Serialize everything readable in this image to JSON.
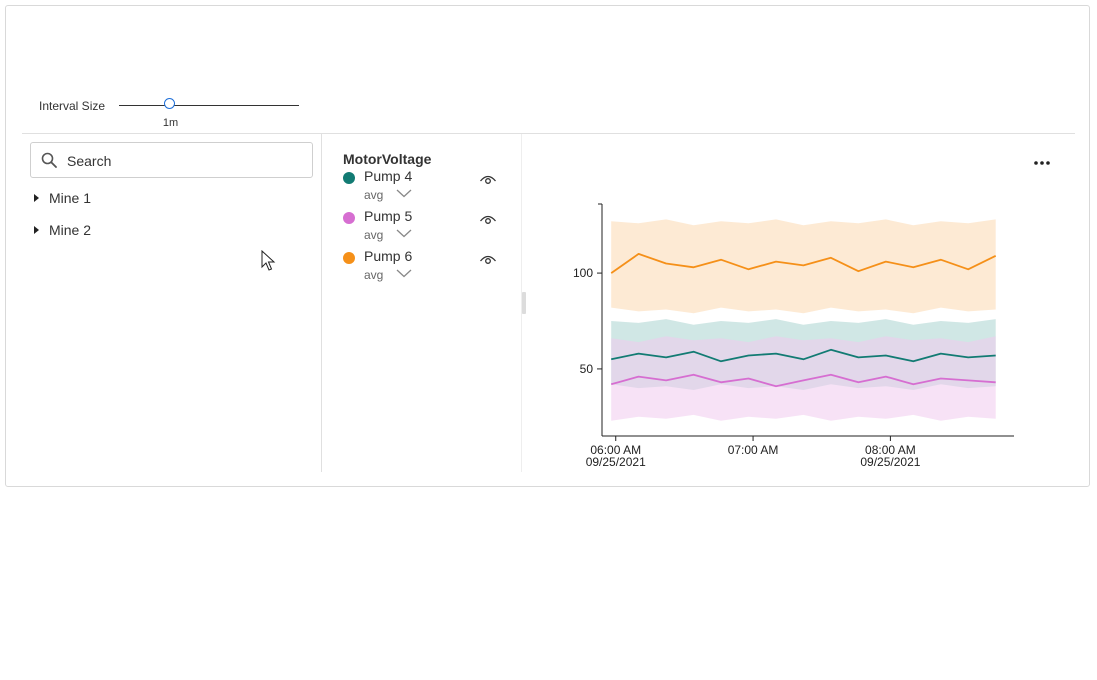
{
  "interval": {
    "label": "Interval Size",
    "value": "1m",
    "slider_fraction": 0.28
  },
  "search": {
    "placeholder": "Search",
    "value": ""
  },
  "tree": {
    "items": [
      {
        "label": "Mine 1"
      },
      {
        "label": "Mine 2"
      }
    ]
  },
  "legend": {
    "title": "MotorVoltage",
    "items": [
      {
        "name": "Pump 4",
        "aggregate": "avg",
        "color": "#127b73",
        "icons": [
          "chevron-down-icon",
          "eye-icon"
        ]
      },
      {
        "name": "Pump 5",
        "aggregate": "avg",
        "color": "#d66ed1",
        "icons": [
          "chevron-down-icon",
          "eye-icon"
        ]
      },
      {
        "name": "Pump 6",
        "aggregate": "avg",
        "color": "#f59019",
        "icons": [
          "chevron-down-icon",
          "eye-icon"
        ]
      }
    ]
  },
  "chart_data": {
    "type": "line",
    "ylim": [
      15,
      135
    ],
    "yticks": [
      {
        "value": 50,
        "label": "50"
      },
      {
        "value": 100,
        "label": "100"
      }
    ],
    "xlim": [
      "2021-09-25T05:54",
      "2021-09-25T08:54"
    ],
    "xticks": [
      {
        "time": "2021-09-25T06:00",
        "label": "06:00 AM",
        "sublabel": "09/25/2021"
      },
      {
        "time": "2021-09-25T07:00",
        "label": "07:00 AM",
        "sublabel": ""
      },
      {
        "time": "2021-09-25T08:00",
        "label": "08:00 AM",
        "sublabel": "09/25/2021"
      }
    ],
    "series": [
      {
        "name": "Pump 6",
        "color": "#f59019",
        "band_color": "#fcd9b0",
        "x": [
          "2021-09-25T05:58",
          "2021-09-25T06:10",
          "2021-09-25T06:22",
          "2021-09-25T06:34",
          "2021-09-25T06:46",
          "2021-09-25T06:58",
          "2021-09-25T07:10",
          "2021-09-25T07:22",
          "2021-09-25T07:34",
          "2021-09-25T07:46",
          "2021-09-25T07:58",
          "2021-09-25T08:10",
          "2021-09-25T08:22",
          "2021-09-25T08:34",
          "2021-09-25T08:46"
        ],
        "avg": [
          100,
          110,
          105,
          103,
          107,
          102,
          106,
          104,
          108,
          101,
          106,
          103,
          107,
          102,
          109
        ],
        "min": [
          82,
          80,
          81,
          79,
          82,
          80,
          81,
          79,
          82,
          80,
          81,
          79,
          82,
          80,
          81
        ],
        "max": [
          127,
          126,
          128,
          125,
          127,
          126,
          128,
          125,
          127,
          126,
          128,
          125,
          127,
          126,
          128
        ]
      },
      {
        "name": "Pump 4",
        "color": "#127b73",
        "band_color": "#a9d4cf",
        "x": [
          "2021-09-25T05:58",
          "2021-09-25T06:10",
          "2021-09-25T06:22",
          "2021-09-25T06:34",
          "2021-09-25T06:46",
          "2021-09-25T06:58",
          "2021-09-25T07:10",
          "2021-09-25T07:22",
          "2021-09-25T07:34",
          "2021-09-25T07:46",
          "2021-09-25T07:58",
          "2021-09-25T08:10",
          "2021-09-25T08:22",
          "2021-09-25T08:34",
          "2021-09-25T08:46"
        ],
        "avg": [
          55,
          58,
          56,
          59,
          54,
          57,
          58,
          55,
          60,
          56,
          57,
          54,
          58,
          56,
          57
        ],
        "min": [
          42,
          40,
          41,
          39,
          42,
          40,
          41,
          39,
          42,
          40,
          41,
          39,
          42,
          40,
          41
        ],
        "max": [
          75,
          74,
          76,
          73,
          75,
          74,
          76,
          73,
          75,
          74,
          76,
          73,
          75,
          74,
          76
        ]
      },
      {
        "name": "Pump 5",
        "color": "#d66ed1",
        "band_color": "#f0cbee",
        "x": [
          "2021-09-25T05:58",
          "2021-09-25T06:10",
          "2021-09-25T06:22",
          "2021-09-25T06:34",
          "2021-09-25T06:46",
          "2021-09-25T06:58",
          "2021-09-25T07:10",
          "2021-09-25T07:22",
          "2021-09-25T07:34",
          "2021-09-25T07:46",
          "2021-09-25T07:58",
          "2021-09-25T08:10",
          "2021-09-25T08:22",
          "2021-09-25T08:34",
          "2021-09-25T08:46"
        ],
        "avg": [
          42,
          46,
          44,
          47,
          43,
          45,
          41,
          44,
          47,
          43,
          46,
          42,
          45,
          44,
          43
        ],
        "min": [
          23,
          25,
          24,
          26,
          23,
          25,
          24,
          26,
          23,
          25,
          24,
          26,
          23,
          25,
          24
        ],
        "max": [
          66,
          64,
          67,
          65,
          66,
          64,
          67,
          65,
          66,
          64,
          67,
          65,
          66,
          64,
          67
        ]
      }
    ]
  }
}
